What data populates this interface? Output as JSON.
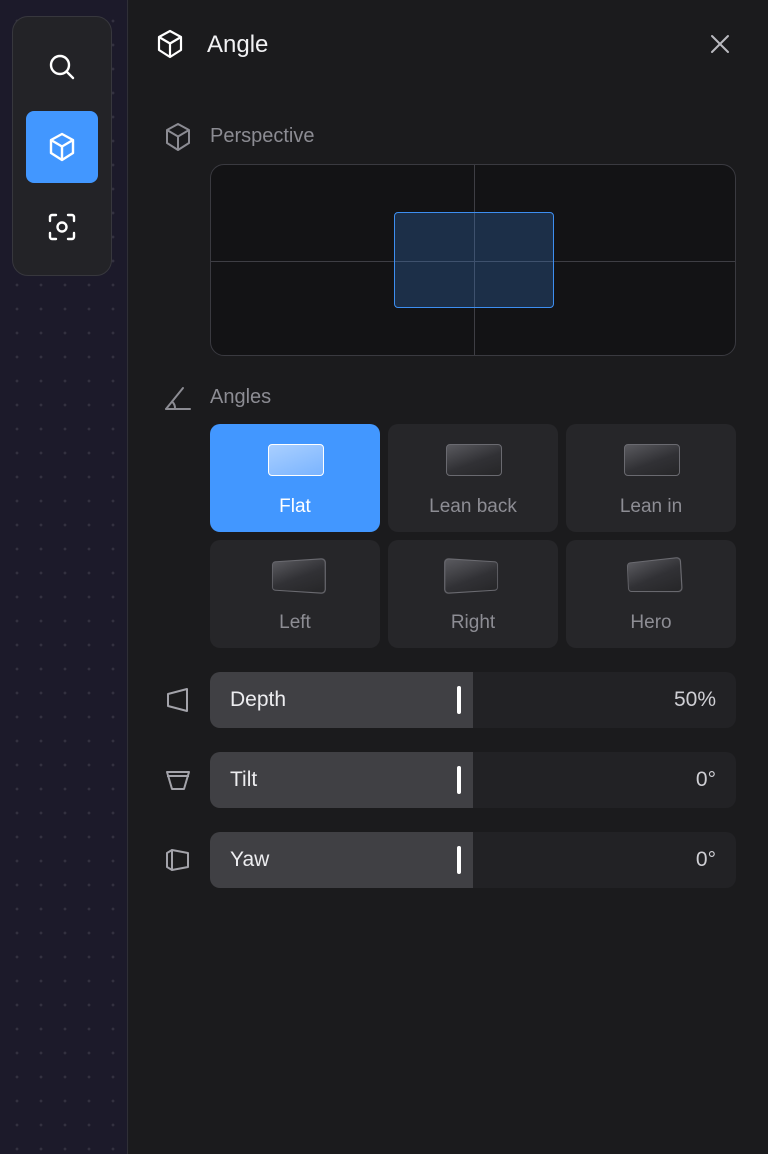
{
  "toolbar": {
    "tools": [
      {
        "name": "search",
        "icon": "search-icon",
        "active": false
      },
      {
        "name": "angle",
        "icon": "cube-icon",
        "active": true
      },
      {
        "name": "focus",
        "icon": "focus-icon",
        "active": false
      }
    ]
  },
  "panel": {
    "title": "Angle",
    "header_icon": "cube-icon",
    "close_icon": "close-icon"
  },
  "perspective": {
    "label": "Perspective",
    "icon": "cube-icon"
  },
  "angles": {
    "label": "Angles",
    "icon": "angle-icon",
    "presets": [
      {
        "label": "Flat",
        "selected": true
      },
      {
        "label": "Lean back",
        "selected": false
      },
      {
        "label": "Lean in",
        "selected": false
      },
      {
        "label": "Left",
        "selected": false
      },
      {
        "label": "Right",
        "selected": false
      },
      {
        "label": "Hero",
        "selected": false
      }
    ]
  },
  "sliders": {
    "depth": {
      "label": "Depth",
      "value": "50%",
      "fraction": 0.5,
      "icon": "depth-icon"
    },
    "tilt": {
      "label": "Tilt",
      "value": "0°",
      "fraction": 0.5,
      "icon": "tilt-icon"
    },
    "yaw": {
      "label": "Yaw",
      "value": "0°",
      "fraction": 0.5,
      "icon": "yaw-icon"
    }
  },
  "colors": {
    "accent": "#4297ff",
    "panel_bg": "#1b1b1d",
    "card_bg": "#262629"
  }
}
